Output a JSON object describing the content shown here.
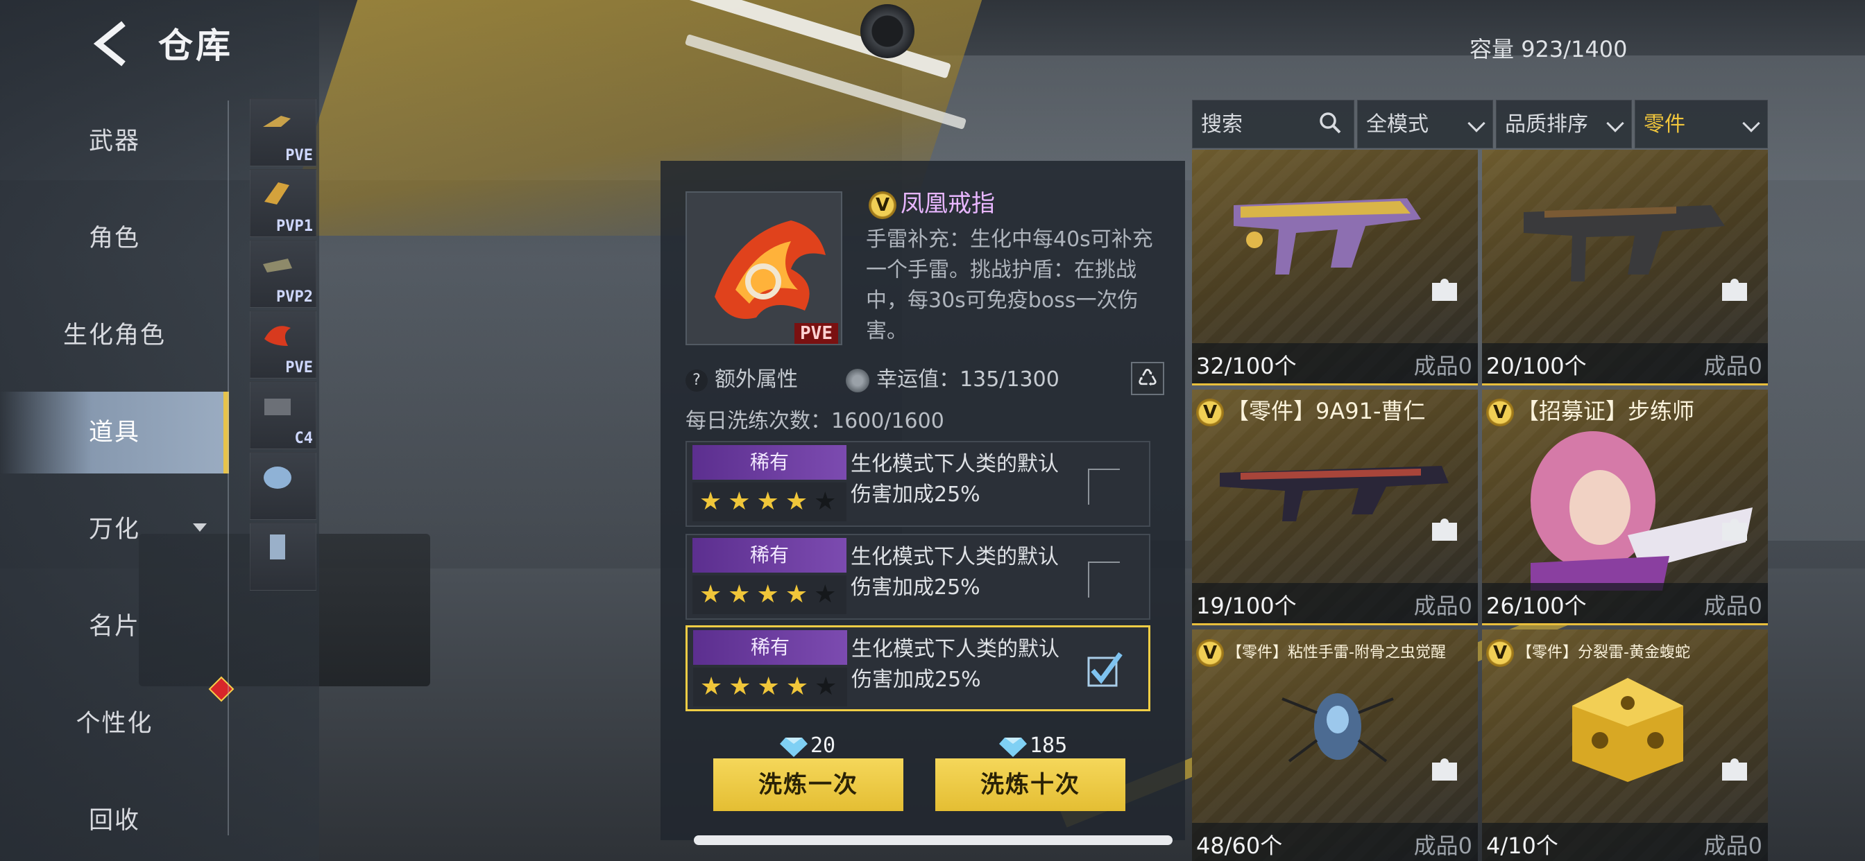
{
  "header": {
    "title": "仓库",
    "capacity_label": "容量",
    "capacity_value": "923/1400"
  },
  "sidebar": {
    "items": [
      {
        "label": "武器"
      },
      {
        "label": "角色"
      },
      {
        "label": "生化角色"
      },
      {
        "label": "道具",
        "active": true
      },
      {
        "label": "万化"
      },
      {
        "label": "名片"
      },
      {
        "label": "个性化"
      },
      {
        "label": "回收"
      }
    ]
  },
  "thumbnails": [
    {
      "tag": "PVE"
    },
    {
      "tag": "PVP1"
    },
    {
      "tag": "PVP2"
    },
    {
      "tag": "PVE"
    },
    {
      "tag": "C4"
    },
    {
      "tag": ""
    },
    {
      "tag": ""
    }
  ],
  "detail": {
    "badge": "V",
    "name": "凤凰戒指",
    "icon_tag": "PVE",
    "description": "手雷补充：生化中每40s可补充一个手雷。挑战护盾：在挑战中，每30s可免疫boss一次伤害。",
    "extra_attr_label": "额外属性",
    "luck_label": "幸运值：135/1300",
    "daily_label": "每日洗练次数：1600/1600",
    "options": [
      {
        "rarity": "稀有",
        "stars_filled": 4,
        "stars_total": 5,
        "text": "生化模式下人类的默认伤害加成25%",
        "checked": false
      },
      {
        "rarity": "稀有",
        "stars_filled": 4,
        "stars_total": 5,
        "text": "生化模式下人类的默认伤害加成25%",
        "checked": false
      },
      {
        "rarity": "稀有",
        "stars_filled": 4,
        "stars_total": 5,
        "text": "生化模式下人类的默认伤害加成25%",
        "checked": true
      }
    ],
    "cost_once": "20",
    "cost_ten": "185",
    "btn_once": "洗炼一次",
    "btn_ten": "洗炼十次"
  },
  "filters": {
    "search_placeholder": "搜索",
    "mode": "全模式",
    "sort": "品质排序",
    "category": "零件"
  },
  "grid": {
    "cards": [
      {
        "title": "",
        "count": "32/100个",
        "done": "成品0",
        "art": "gun-ornate"
      },
      {
        "title": "",
        "count": "20/100个",
        "done": "成品0",
        "art": "gun-dark"
      },
      {
        "badge": "V",
        "title": "【零件】9A91-曹仁",
        "count": "19/100个",
        "done": "成品0",
        "art": "rifle"
      },
      {
        "badge": "V",
        "title": "【招募证】步练师",
        "count": "26/100个",
        "done": "成品0",
        "art": "character"
      },
      {
        "badge": "V",
        "title": "【零件】粘性手雷-附骨之虫觉醒",
        "count": "48/60个",
        "done": "成品0",
        "art": "beetle"
      },
      {
        "badge": "V",
        "title": "【零件】分裂雷-黄金蝮蛇",
        "count": "4/10个",
        "done": "成品0",
        "art": "gold-cube"
      }
    ]
  },
  "colors": {
    "accent_gold": "#efcd45",
    "rare_purple": "#6c3da0",
    "item_name": "#e8b6ff"
  }
}
